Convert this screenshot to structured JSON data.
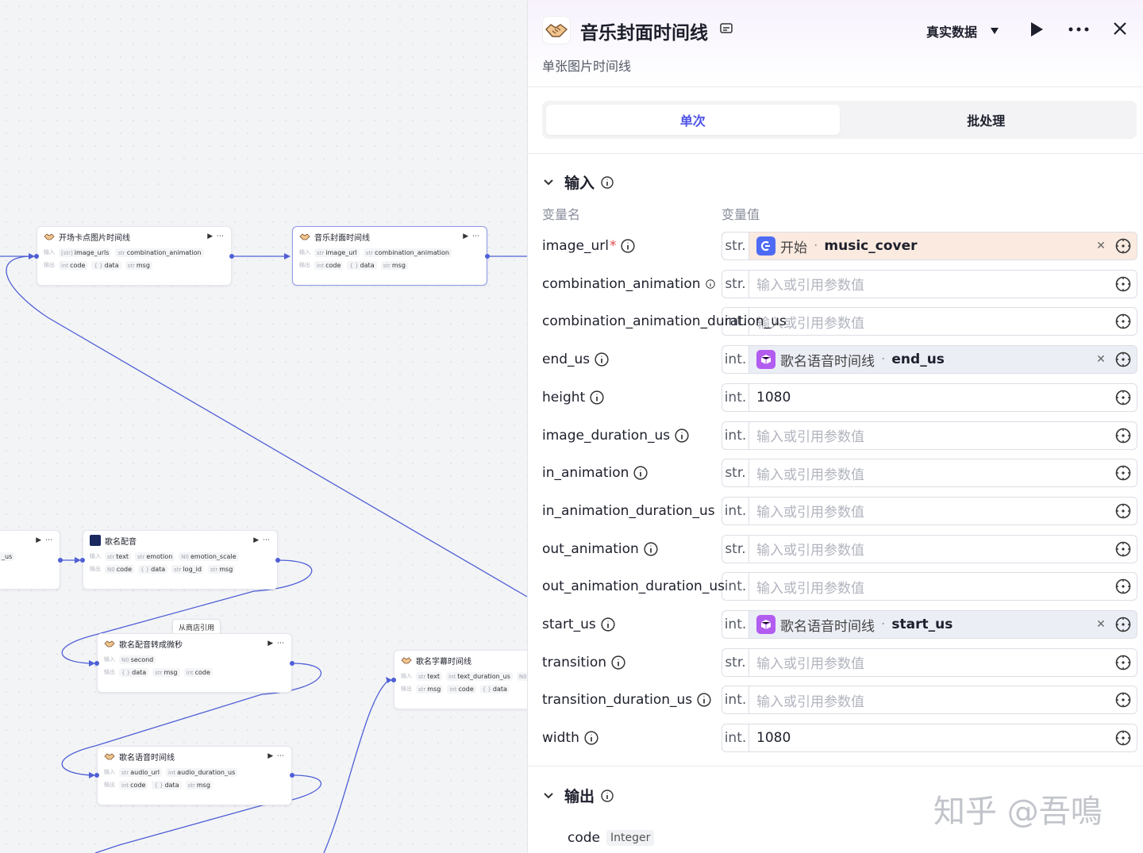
{
  "canvas": {
    "tooltip": "从商店引用",
    "nodes": {
      "kaichang": {
        "title": "开场卡点图片时间线",
        "in_label": "输入",
        "out_label": "输出",
        "inputs": [
          {
            "t": "[str]",
            "n": "image_urls"
          },
          {
            "t": "str",
            "n": "combination_animation"
          }
        ],
        "outputs": [
          {
            "t": "int",
            "n": "code"
          },
          {
            "t": "{ }",
            "n": "data"
          },
          {
            "t": "str",
            "n": "msg"
          }
        ]
      },
      "yinyue": {
        "title": "音乐封面时间线",
        "in_label": "输入",
        "out_label": "输出",
        "inputs": [
          {
            "t": "str",
            "n": "image_url"
          },
          {
            "t": "str",
            "n": "combination_animation"
          }
        ],
        "outputs": [
          {
            "t": "int",
            "n": "code"
          },
          {
            "t": "{ }",
            "n": "data"
          },
          {
            "t": "str",
            "n": "msg"
          }
        ]
      },
      "left_partial": {
        "row": "_us"
      },
      "peiyin": {
        "title": "歌名配音",
        "in_label": "输入",
        "out_label": "输出",
        "inputs": [
          {
            "t": "str",
            "n": "text"
          },
          {
            "t": "str",
            "n": "emotion"
          },
          {
            "t": "N0",
            "n": "emotion_scale"
          }
        ],
        "outputs": [
          {
            "t": "N0",
            "n": "code"
          },
          {
            "t": "{ }",
            "n": "data"
          },
          {
            "t": "str",
            "n": "log_id"
          },
          {
            "t": "str",
            "n": "msg"
          }
        ]
      },
      "zhuanhuan": {
        "title": "歌名配音转成微秒",
        "in_label": "输入",
        "out_label": "输出",
        "inputs": [
          {
            "t": "N0",
            "n": "second"
          }
        ],
        "outputs": [
          {
            "t": "{ }",
            "n": "data"
          },
          {
            "t": "str",
            "n": "msg"
          },
          {
            "t": "int",
            "n": "code"
          }
        ]
      },
      "zimu": {
        "title": "歌名字幕时间线",
        "in_label": "输入",
        "out_label": "输出",
        "inputs": [
          {
            "t": "str",
            "n": "text"
          },
          {
            "t": "int",
            "n": "text_duration_us"
          },
          {
            "t": "N0",
            "n": ""
          }
        ],
        "outputs": [
          {
            "t": "str",
            "n": "msg"
          },
          {
            "t": "int",
            "n": "code"
          },
          {
            "t": "{ }",
            "n": "data"
          }
        ]
      },
      "yuyin": {
        "title": "歌名语音时间线",
        "in_label": "输入",
        "out_label": "输出",
        "inputs": [
          {
            "t": "str",
            "n": "audio_url"
          },
          {
            "t": "int",
            "n": "audio_duration_us"
          }
        ],
        "outputs": [
          {
            "t": "int",
            "n": "code"
          },
          {
            "t": "{ }",
            "n": "data"
          },
          {
            "t": "str",
            "n": "msg"
          }
        ]
      }
    }
  },
  "panel": {
    "title": "音乐封面时间线",
    "subtitle": "单张图片时间线",
    "mode": "真实数据",
    "tabs": [
      {
        "label": "单次",
        "active": true
      },
      {
        "label": "批处理",
        "active": false
      }
    ],
    "input_section": "输入",
    "col_name": "变量名",
    "col_value": "变量值",
    "placeholder": "输入或引用参数值",
    "params": [
      {
        "name": "image_url",
        "required": true,
        "type": "str.",
        "kind": "ref",
        "ref_color": "orange",
        "ref_src": "开始",
        "ref_var": "music_cover"
      },
      {
        "name": "combination_animation",
        "type": "str.",
        "kind": "empty",
        "info_small": true
      },
      {
        "name": "combination_animation_duration_us",
        "type": "int.",
        "kind": "empty",
        "no_info": true
      },
      {
        "name": "end_us",
        "type": "int.",
        "kind": "ref",
        "ref_color": "purple",
        "ref_src": "歌名语音时间线",
        "ref_var": "end_us"
      },
      {
        "name": "height",
        "type": "int.",
        "kind": "value",
        "value": "1080"
      },
      {
        "name": "image_duration_us",
        "type": "int.",
        "kind": "empty"
      },
      {
        "name": "in_animation",
        "type": "str.",
        "kind": "empty"
      },
      {
        "name": "in_animation_duration_us",
        "type": "int.",
        "kind": "empty",
        "no_info": true
      },
      {
        "name": "out_animation",
        "type": "str.",
        "kind": "empty"
      },
      {
        "name": "out_animation_duration_us",
        "type": "int.",
        "kind": "empty",
        "no_info": true
      },
      {
        "name": "start_us",
        "type": "int.",
        "kind": "ref",
        "ref_color": "purple",
        "ref_src": "歌名语音时间线",
        "ref_var": "start_us"
      },
      {
        "name": "transition",
        "type": "str.",
        "kind": "empty"
      },
      {
        "name": "transition_duration_us",
        "type": "int.",
        "kind": "empty"
      },
      {
        "name": "width",
        "type": "int.",
        "kind": "value",
        "value": "1080"
      }
    ],
    "output_section": "输出",
    "outputs": [
      {
        "name": "code",
        "type": "Integer"
      }
    ]
  },
  "watermark": "知乎 @吾鳴",
  "colors": {
    "accent": "#4d53e8",
    "edge": "#4e5fd6",
    "ref_orange_bg": "#fbeae0",
    "ref_purple_bg": "#eceef6"
  }
}
